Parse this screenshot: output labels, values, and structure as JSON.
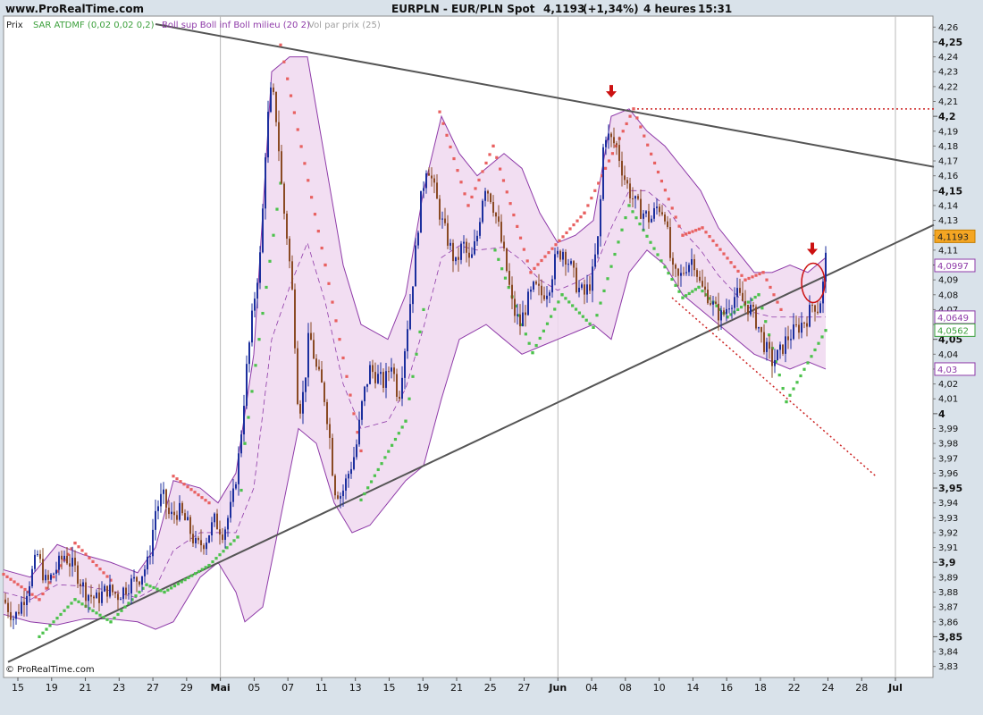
{
  "header": {
    "site": "www.ProRealTime.com",
    "title": "EURPLN - EUR/PLN Spot",
    "price": "4,1193",
    "change": "(+1,34%)",
    "period": "4 heures",
    "time": "15:31"
  },
  "legend": {
    "price_label": "Prix",
    "sar_label": "SAR ATDMF (0,02 0,02 0,2)",
    "boll_label": "Boll sup Boll inf Boll milieu (20 2)",
    "vol_label": "Vol par prix (25)"
  },
  "copyright": "© ProRealTime.com",
  "colors": {
    "background": "#d9e2ea",
    "plot_bg": "#ffffff",
    "grid": "#cfcfcf",
    "candle_up": "#1c2f9e",
    "candle_down": "#8a4a24",
    "sar_up": "#4cc24c",
    "sar_down": "#e86060",
    "bollinger_fill": "#f0d8f0",
    "bollinger_line": "#8e3aa8",
    "trend_line": "#555555",
    "dotted_line": "#cc2222",
    "arrow": "#cc1111"
  },
  "badges": {
    "last_price": "4,1193",
    "boll_upper": "4,0997",
    "boll_middle": "4,0649",
    "sar": "4,0562",
    "boll_lower": "4,03"
  },
  "chart_data": {
    "type": "line",
    "title": "EURPLN - EUR/PLN Spot",
    "ylim": [
      3.825,
      4.265
    ],
    "y_major_ticks": [
      "3,85",
      "3,9",
      "3,95",
      "4",
      "4,05",
      "4,1",
      "4,15",
      "4,2",
      "4,25"
    ],
    "y_minor_ticks": [
      "3,83",
      "3,84",
      "3,86",
      "3,87",
      "3,88",
      "3,89",
      "3,91",
      "3,92",
      "3,93",
      "3,94",
      "3,96",
      "3,97",
      "3,98",
      "3,99",
      "4,01",
      "4,02",
      "4,03",
      "4,04",
      "4,06",
      "4,07",
      "4,08",
      "4,09",
      "4,11",
      "4,12",
      "4,13",
      "4,14",
      "4,16",
      "4,17",
      "4,18",
      "4,19",
      "4,21",
      "4,22",
      "4,23",
      "4,24",
      "4,26"
    ],
    "x_tick_labels": [
      "15",
      "19",
      "21",
      "23",
      "27",
      "29",
      "Mai",
      "05",
      "07",
      "11",
      "13",
      "15",
      "19",
      "21",
      "25",
      "27",
      "Jun",
      "04",
      "08",
      "10",
      "14",
      "16",
      "18",
      "22",
      "24",
      "28",
      "Jul"
    ],
    "x_major_labels": [
      "Mai",
      "Jun",
      "Jul"
    ],
    "price_path": [
      [
        0,
        3.875
      ],
      [
        12,
        3.862
      ],
      [
        24,
        3.878
      ],
      [
        38,
        3.905
      ],
      [
        48,
        3.885
      ],
      [
        58,
        3.895
      ],
      [
        68,
        3.905
      ],
      [
        80,
        3.895
      ],
      [
        92,
        3.88
      ],
      [
        104,
        3.875
      ],
      [
        116,
        3.882
      ],
      [
        128,
        3.878
      ],
      [
        140,
        3.885
      ],
      [
        152,
        3.89
      ],
      [
        162,
        3.9
      ],
      [
        170,
        3.935
      ],
      [
        178,
        3.945
      ],
      [
        186,
        3.93
      ],
      [
        196,
        3.935
      ],
      [
        206,
        3.925
      ],
      [
        216,
        3.91
      ],
      [
        226,
        3.915
      ],
      [
        236,
        3.928
      ],
      [
        246,
        3.92
      ],
      [
        256,
        3.94
      ],
      [
        264,
        3.975
      ],
      [
        272,
        4.03
      ],
      [
        280,
        4.075
      ],
      [
        288,
        4.11
      ],
      [
        294,
        4.19
      ],
      [
        300,
        4.22
      ],
      [
        306,
        4.195
      ],
      [
        312,
        4.145
      ],
      [
        318,
        4.115
      ],
      [
        324,
        4.075
      ],
      [
        330,
        4.0
      ],
      [
        336,
        4.015
      ],
      [
        342,
        4.055
      ],
      [
        350,
        4.03
      ],
      [
        358,
        4.015
      ],
      [
        364,
        3.99
      ],
      [
        370,
        3.95
      ],
      [
        378,
        3.945
      ],
      [
        386,
        3.96
      ],
      [
        394,
        3.975
      ],
      [
        402,
        4.01
      ],
      [
        410,
        4.03
      ],
      [
        418,
        4.025
      ],
      [
        426,
        4.02
      ],
      [
        434,
        4.035
      ],
      [
        442,
        4.01
      ],
      [
        450,
        4.05
      ],
      [
        458,
        4.09
      ],
      [
        466,
        4.14
      ],
      [
        474,
        4.17
      ],
      [
        482,
        4.15
      ],
      [
        490,
        4.13
      ],
      [
        498,
        4.115
      ],
      [
        506,
        4.1
      ],
      [
        514,
        4.115
      ],
      [
        522,
        4.1
      ],
      [
        530,
        4.12
      ],
      [
        538,
        4.155
      ],
      [
        546,
        4.145
      ],
      [
        554,
        4.125
      ],
      [
        562,
        4.1
      ],
      [
        570,
        4.07
      ],
      [
        578,
        4.06
      ],
      [
        586,
        4.075
      ],
      [
        594,
        4.085
      ],
      [
        602,
        4.08
      ],
      [
        610,
        4.085
      ],
      [
        618,
        4.105
      ],
      [
        626,
        4.11
      ],
      [
        634,
        4.1
      ],
      [
        642,
        4.085
      ],
      [
        650,
        4.08
      ],
      [
        658,
        4.09
      ],
      [
        666,
        4.12
      ],
      [
        672,
        4.19
      ],
      [
        678,
        4.185
      ],
      [
        686,
        4.18
      ],
      [
        694,
        4.16
      ],
      [
        700,
        4.15
      ],
      [
        708,
        4.14
      ],
      [
        716,
        4.135
      ],
      [
        724,
        4.13
      ],
      [
        732,
        4.14
      ],
      [
        740,
        4.135
      ],
      [
        748,
        4.095
      ],
      [
        756,
        4.09
      ],
      [
        764,
        4.1
      ],
      [
        772,
        4.105
      ],
      [
        780,
        4.085
      ],
      [
        788,
        4.08
      ],
      [
        796,
        4.07
      ],
      [
        804,
        4.065
      ],
      [
        812,
        4.075
      ],
      [
        820,
        4.08
      ],
      [
        828,
        4.075
      ],
      [
        836,
        4.07
      ],
      [
        844,
        4.06
      ],
      [
        852,
        4.045
      ],
      [
        860,
        4.035
      ],
      [
        868,
        4.04
      ],
      [
        876,
        4.05
      ],
      [
        884,
        4.055
      ],
      [
        892,
        4.06
      ],
      [
        900,
        4.065
      ],
      [
        906,
        4.075
      ],
      [
        912,
        4.07
      ],
      [
        918,
        4.09
      ],
      [
        922,
        4.119
      ]
    ],
    "boll_upper": [
      [
        0,
        3.895
      ],
      [
        30,
        3.89
      ],
      [
        60,
        3.912
      ],
      [
        90,
        3.905
      ],
      [
        120,
        3.9
      ],
      [
        150,
        3.893
      ],
      [
        170,
        3.91
      ],
      [
        190,
        3.955
      ],
      [
        220,
        3.95
      ],
      [
        240,
        3.94
      ],
      [
        260,
        3.96
      ],
      [
        280,
        4.04
      ],
      [
        300,
        4.23
      ],
      [
        320,
        4.24
      ],
      [
        340,
        4.24
      ],
      [
        360,
        4.17
      ],
      [
        380,
        4.1
      ],
      [
        400,
        4.06
      ],
      [
        430,
        4.05
      ],
      [
        450,
        4.08
      ],
      [
        470,
        4.15
      ],
      [
        490,
        4.2
      ],
      [
        510,
        4.175
      ],
      [
        530,
        4.16
      ],
      [
        560,
        4.175
      ],
      [
        580,
        4.165
      ],
      [
        600,
        4.135
      ],
      [
        620,
        4.115
      ],
      [
        640,
        4.12
      ],
      [
        660,
        4.13
      ],
      [
        680,
        4.2
      ],
      [
        700,
        4.205
      ],
      [
        720,
        4.19
      ],
      [
        740,
        4.18
      ],
      [
        760,
        4.165
      ],
      [
        780,
        4.15
      ],
      [
        800,
        4.125
      ],
      [
        820,
        4.11
      ],
      [
        840,
        4.095
      ],
      [
        860,
        4.095
      ],
      [
        880,
        4.1
      ],
      [
        900,
        4.095
      ],
      [
        920,
        4.105
      ]
    ],
    "boll_lower": [
      [
        0,
        3.865
      ],
      [
        30,
        3.86
      ],
      [
        60,
        3.858
      ],
      [
        90,
        3.862
      ],
      [
        120,
        3.862
      ],
      [
        150,
        3.86
      ],
      [
        170,
        3.855
      ],
      [
        190,
        3.86
      ],
      [
        220,
        3.89
      ],
      [
        240,
        3.9
      ],
      [
        260,
        3.88
      ],
      [
        270,
        3.86
      ],
      [
        290,
        3.87
      ],
      [
        310,
        3.93
      ],
      [
        330,
        3.99
      ],
      [
        350,
        3.98
      ],
      [
        370,
        3.94
      ],
      [
        390,
        3.92
      ],
      [
        410,
        3.925
      ],
      [
        430,
        3.94
      ],
      [
        450,
        3.955
      ],
      [
        470,
        3.965
      ],
      [
        490,
        4.01
      ],
      [
        510,
        4.05
      ],
      [
        540,
        4.06
      ],
      [
        560,
        4.05
      ],
      [
        580,
        4.04
      ],
      [
        600,
        4.045
      ],
      [
        620,
        4.05
      ],
      [
        640,
        4.055
      ],
      [
        660,
        4.06
      ],
      [
        680,
        4.05
      ],
      [
        700,
        4.095
      ],
      [
        720,
        4.11
      ],
      [
        740,
        4.1
      ],
      [
        760,
        4.08
      ],
      [
        780,
        4.07
      ],
      [
        800,
        4.06
      ],
      [
        820,
        4.05
      ],
      [
        840,
        4.04
      ],
      [
        860,
        4.035
      ],
      [
        880,
        4.03
      ],
      [
        900,
        4.035
      ],
      [
        920,
        4.03
      ]
    ],
    "boll_middle": [
      [
        0,
        3.88
      ],
      [
        30,
        3.875
      ],
      [
        60,
        3.885
      ],
      [
        90,
        3.884
      ],
      [
        120,
        3.881
      ],
      [
        150,
        3.876
      ],
      [
        170,
        3.883
      ],
      [
        190,
        3.908
      ],
      [
        220,
        3.92
      ],
      [
        240,
        3.92
      ],
      [
        260,
        3.92
      ],
      [
        280,
        3.95
      ],
      [
        300,
        4.05
      ],
      [
        320,
        4.085
      ],
      [
        340,
        4.115
      ],
      [
        360,
        4.075
      ],
      [
        380,
        4.02
      ],
      [
        400,
        3.99
      ],
      [
        430,
        3.995
      ],
      [
        450,
        4.017
      ],
      [
        470,
        4.058
      ],
      [
        490,
        4.105
      ],
      [
        510,
        4.113
      ],
      [
        530,
        4.11
      ],
      [
        560,
        4.112
      ],
      [
        580,
        4.103
      ],
      [
        600,
        4.09
      ],
      [
        620,
        4.083
      ],
      [
        640,
        4.088
      ],
      [
        660,
        4.095
      ],
      [
        680,
        4.125
      ],
      [
        700,
        4.15
      ],
      [
        720,
        4.15
      ],
      [
        740,
        4.14
      ],
      [
        760,
        4.123
      ],
      [
        780,
        4.11
      ],
      [
        800,
        4.093
      ],
      [
        820,
        4.08
      ],
      [
        840,
        4.068
      ],
      [
        860,
        4.065
      ],
      [
        880,
        4.065
      ],
      [
        900,
        4.065
      ],
      [
        920,
        4.065
      ]
    ],
    "sar_down": [
      [
        0,
        3.892
      ],
      [
        40,
        3.875
      ],
      [
        80,
        3.913
      ],
      [
        120,
        3.888
      ],
      [
        190,
        3.958
      ],
      [
        230,
        3.94
      ],
      [
        310,
        4.248
      ],
      [
        360,
        4.1
      ],
      [
        400,
        3.975
      ],
      [
        488,
        4.203
      ],
      [
        520,
        4.14
      ],
      [
        548,
        4.18
      ],
      [
        590,
        4.095
      ],
      [
        650,
        4.135
      ],
      [
        705,
        4.205
      ],
      [
        760,
        4.12
      ],
      [
        782,
        4.125
      ],
      [
        830,
        4.09
      ],
      [
        850,
        4.095
      ],
      [
        870,
        4.07
      ]
    ],
    "sar_up": [
      [
        40,
        3.85
      ],
      [
        80,
        3.875
      ],
      [
        120,
        3.86
      ],
      [
        160,
        3.885
      ],
      [
        180,
        3.88
      ],
      [
        230,
        3.898
      ],
      [
        262,
        3.917
      ],
      [
        270,
        3.98
      ],
      [
        310,
        4.155
      ],
      [
        400,
        3.942
      ],
      [
        450,
        3.995
      ],
      [
        470,
        4.07
      ],
      [
        550,
        4.11
      ],
      [
        592,
        4.041
      ],
      [
        625,
        4.08
      ],
      [
        660,
        4.058
      ],
      [
        700,
        4.14
      ],
      [
        760,
        4.078
      ],
      [
        778,
        4.085
      ],
      [
        810,
        4.065
      ],
      [
        845,
        4.08
      ],
      [
        876,
        4.008
      ],
      [
        920,
        4.056
      ]
    ],
    "trendlines": [
      {
        "from": [
          170,
          4.262
        ],
        "to": [
          1041,
          4.166
        ]
      },
      {
        "from": [
          5,
          3.833
        ],
        "to": [
          1041,
          4.127
        ]
      }
    ],
    "dotted_lines": [
      {
        "from": [
          704,
          4.205
        ],
        "to": [
          1041,
          4.205
        ]
      },
      {
        "from": [
          748,
          4.078
        ],
        "to": [
          976,
          3.958
        ]
      }
    ],
    "annotations": [
      {
        "type": "arrow",
        "at": [
          680,
          4.215
        ]
      },
      {
        "type": "arrow",
        "at": [
          905,
          4.109
        ]
      },
      {
        "type": "circle",
        "at": [
          906,
          4.088
        ]
      }
    ]
  }
}
